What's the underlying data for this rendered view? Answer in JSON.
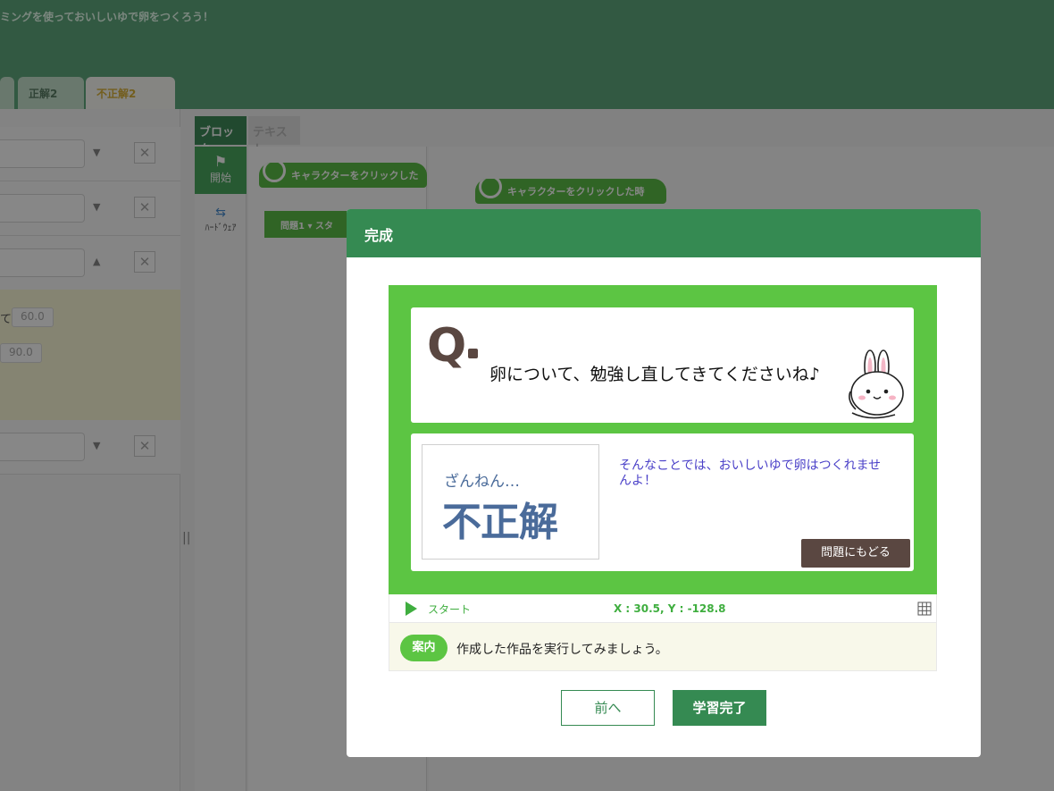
{
  "app": {
    "subtitle": "ミングを使っておいしいゆで卵をつくろう！",
    "tabs": [
      "",
      "正解2",
      "不正解2"
    ]
  },
  "left_panel": {
    "values": [
      "60.0",
      "90.0"
    ],
    "label_fragment": "て"
  },
  "block_editor": {
    "tabs": {
      "block": "ブロック",
      "text": "テキスト"
    },
    "palette": {
      "start": "開始",
      "hardware": "ﾊｰﾄﾞｳｪｱ"
    },
    "hat_block": "キャラクターをクリックした時",
    "hat_block_truncated": "キャラクターをクリックした",
    "question_block": "問題1 ▾  スタ",
    "splitter": "||"
  },
  "modal": {
    "title": "完成",
    "stage": {
      "question_mark": "Q",
      "question_text": "卵について、勉強し直してきてくださいね♪",
      "verdict_small": "ざんねん…",
      "verdict_big": "不正解",
      "answer_message": "そんなことでは、おいしいゆで卵はつくれませんよ！",
      "back_button": "問題にもどる"
    },
    "runbar": {
      "start_label": "スタート",
      "coords": "X : 30.5, Y : -128.8"
    },
    "guide": {
      "badge": "案内",
      "text": "作成した作品を実行してみましょう。"
    },
    "buttons": {
      "prev": "前へ",
      "done": "学習完了"
    }
  },
  "colors": {
    "header_green": "#358a52",
    "stage_green": "#5cc543",
    "verdict_blue": "#4a6b9a",
    "message_purple": "#4a40c8",
    "brown": "#5a4741"
  }
}
